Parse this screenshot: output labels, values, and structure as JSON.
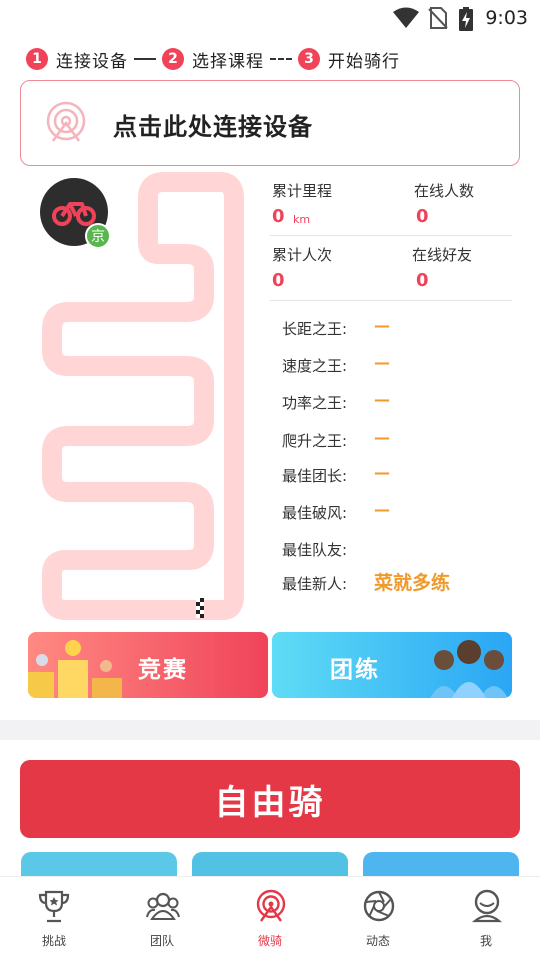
{
  "status_bar": {
    "time": "9:03"
  },
  "steps": [
    {
      "num": "1",
      "label": "连接设备"
    },
    {
      "num": "2",
      "label": "选择课程"
    },
    {
      "num": "3",
      "label": "开始骑行"
    }
  ],
  "connect_card": {
    "text": "点击此处连接设备"
  },
  "avatar": {
    "badge": "京"
  },
  "stats": {
    "total_distance_label": "累计里程",
    "total_distance_value": "0",
    "total_distance_unit": "km",
    "online_users_label": "在线人数",
    "online_users_value": "0",
    "total_rides_label": "累计人次",
    "total_rides_value": "0",
    "online_friends_label": "在线好友",
    "online_friends_value": "0"
  },
  "kings": [
    {
      "label": "长距之王:",
      "value": "—"
    },
    {
      "label": "速度之王:",
      "value": "—"
    },
    {
      "label": "功率之王:",
      "value": "—"
    },
    {
      "label": "爬升之王:",
      "value": "—"
    },
    {
      "label": "最佳团长:",
      "value": "—"
    },
    {
      "label": "最佳破风:",
      "value": "—"
    },
    {
      "label": "最佳队友:",
      "value": ""
    },
    {
      "label": "最佳新人:",
      "value": "菜就多练"
    }
  ],
  "modes": {
    "race": "竞赛",
    "team": "团练"
  },
  "free_ride": "自由骑",
  "bottom_nav": [
    {
      "label": "挑战",
      "icon": "trophy-icon"
    },
    {
      "label": "团队",
      "icon": "team-icon"
    },
    {
      "label": "微骑",
      "icon": "ride-icon",
      "active": true
    },
    {
      "label": "动态",
      "icon": "aperture-icon"
    },
    {
      "label": "我",
      "icon": "profile-icon"
    }
  ],
  "colors": {
    "accent_red": "#e53847",
    "accent_orange": "#f09a2d",
    "team_blue": "#2aa6f5"
  }
}
